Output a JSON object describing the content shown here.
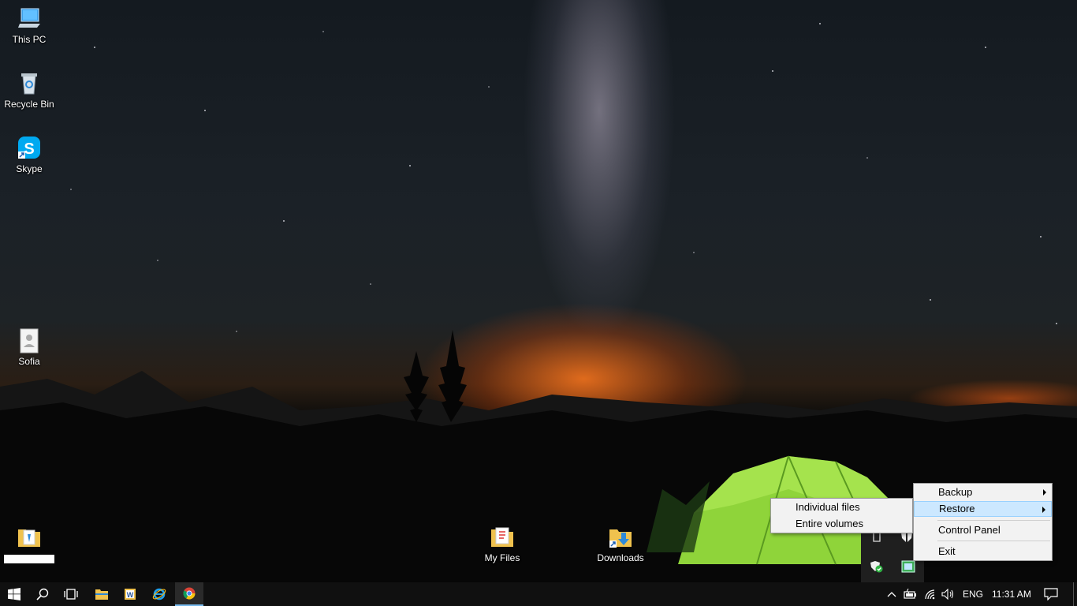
{
  "desktop": {
    "icons": [
      {
        "label": "This PC",
        "icon": "this-pc-icon"
      },
      {
        "label": "Recycle Bin",
        "icon": "recycle-bin-icon"
      },
      {
        "label": "Skype",
        "icon": "skype-icon"
      },
      {
        "label": "Sofia",
        "icon": "user-file-icon"
      },
      {
        "label": "",
        "icon": "folder-icon"
      },
      {
        "label": "My Files",
        "icon": "folder-icon"
      },
      {
        "label": "Downloads",
        "icon": "downloads-folder-icon"
      }
    ]
  },
  "context_menu": {
    "items": [
      {
        "label": "Backup",
        "has_submenu": true
      },
      {
        "label": "Restore",
        "has_submenu": true,
        "highlighted": true
      },
      {
        "label": "Control Panel"
      },
      {
        "label": "Exit"
      }
    ]
  },
  "submenu": {
    "items": [
      {
        "label": "Individual files"
      },
      {
        "label": "Entire volumes"
      }
    ]
  },
  "taskbar": {
    "pinned": [
      "start-icon",
      "search-icon",
      "task-view-icon",
      "file-explorer-icon",
      "word-icon",
      "internet-explorer-icon",
      "chrome-icon"
    ],
    "tray": {
      "language": "ENG",
      "time": "11:31 AM"
    }
  },
  "colors": {
    "taskbar": "#101010",
    "menu_bg": "#f2f2f2",
    "menu_highlight": "#cce8ff",
    "active_app_underline": "#76b9ed"
  }
}
